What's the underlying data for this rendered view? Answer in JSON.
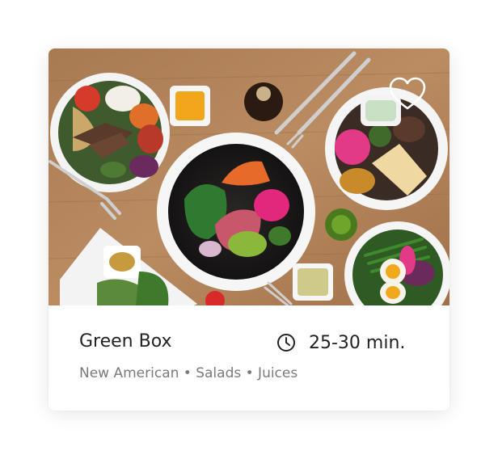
{
  "restaurant": {
    "name": "Green Box",
    "eta": "25-30 min.",
    "cuisines": "New American • Salads • Juices"
  },
  "colors": {
    "text_primary": "#222222",
    "text_secondary": "#7a7a7a",
    "table_wood": "#b2835a"
  },
  "icons": {
    "favorite": "heart-outline-icon",
    "time": "clock-icon"
  }
}
